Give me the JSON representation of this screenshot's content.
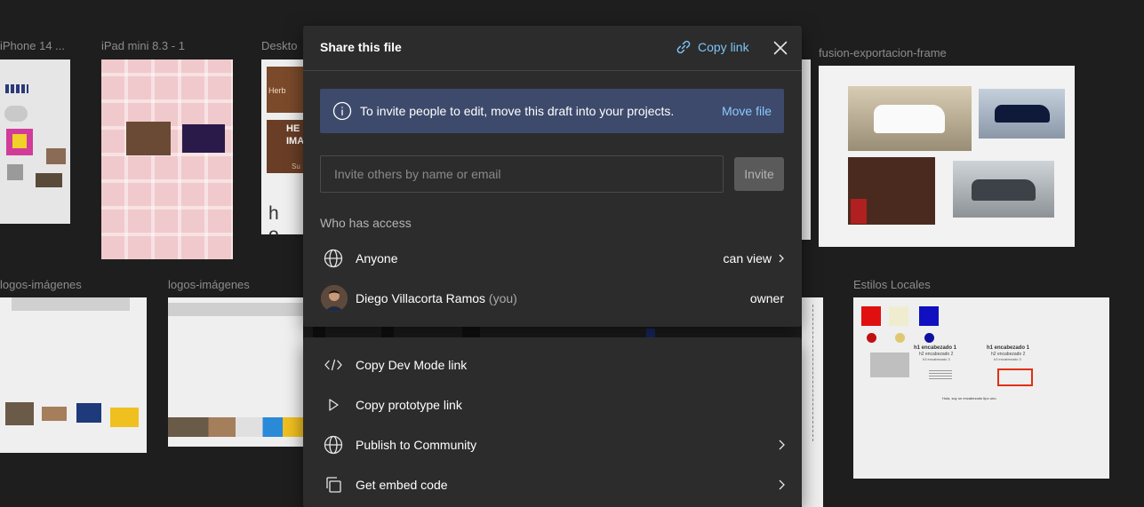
{
  "canvas": {
    "frames": [
      {
        "label": "iPhone 14 ..."
      },
      {
        "label": "iPad mini 8.3 - 1"
      },
      {
        "label": "Deskto"
      },
      {
        "label": "fusion-exportacion-frame"
      },
      {
        "label": "logos-imágenes"
      },
      {
        "label": "logos-imágenes"
      },
      {
        "label": "Estilos Locales"
      }
    ],
    "desktop_fragments": [
      "Herb",
      "HE",
      "IMA",
      "Su",
      "h o"
    ],
    "styles_text": {
      "h1_left": "h1 encabezado 1",
      "h2_left": "h2 encabezado 2",
      "h3_left": "h3 encabezado 3",
      "h1_right": "h1 encabezado 1",
      "h2_right": "h2 encabezado 2",
      "h3_right": "h3 encabezado 3",
      "body": "Hola, soy un encabezado tipo uno."
    }
  },
  "share_modal": {
    "title": "Share this file",
    "copy_link_label": "Copy link",
    "banner_text": "To invite people to edit, move this draft into your projects.",
    "banner_action": "Move file",
    "invite_placeholder": "Invite others by name or email",
    "invite_button": "Invite",
    "access_heading": "Who has access",
    "access": [
      {
        "name": "Anyone",
        "role": "can view"
      },
      {
        "name": "Diego Villacorta Ramos",
        "suffix": "(you)",
        "role": "owner"
      }
    ]
  },
  "menu": {
    "items": [
      {
        "label": "Copy Dev Mode link",
        "icon": "code-icon"
      },
      {
        "label": "Copy prototype link",
        "icon": "play-icon"
      },
      {
        "label": "Publish to Community",
        "icon": "globe-icon"
      },
      {
        "label": "Get embed code",
        "icon": "copy-icon"
      }
    ]
  },
  "colors": {
    "canvas_bg": "#1e1e1e",
    "panel_bg": "#2c2c2c",
    "accent_link": "#7cc4f8",
    "banner_bg": "#3d4a6b"
  }
}
